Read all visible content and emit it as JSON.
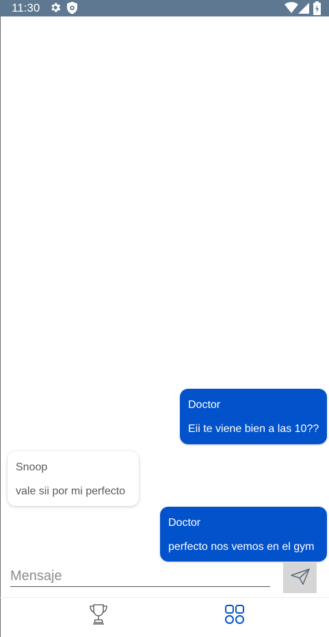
{
  "status_bar": {
    "time": "11:30",
    "icons": [
      "gear-icon",
      "shield-icon",
      "wifi-icon",
      "signal-icon",
      "battery-icon"
    ],
    "background": "#5f7891"
  },
  "messages": [
    {
      "direction": "outgoing",
      "sender": "Doctor",
      "text": "Eii te viene bien a las 10??"
    },
    {
      "direction": "incoming",
      "sender": "Snoop",
      "text": "vale sii por mi perfecto"
    },
    {
      "direction": "outgoing",
      "sender": "Doctor",
      "text": "perfecto nos vemos en el gym"
    }
  ],
  "composer": {
    "placeholder": "Mensaje",
    "value": "",
    "send_icon": "send-icon"
  },
  "bottom_nav": {
    "items": [
      {
        "icon": "trophy-icon",
        "selected": false
      },
      {
        "icon": "grid-icon",
        "selected": true
      }
    ]
  },
  "colors": {
    "outgoing_bubble": "#0252cc",
    "incoming_bubble": "#ffffff",
    "accent": "#0252cc"
  }
}
